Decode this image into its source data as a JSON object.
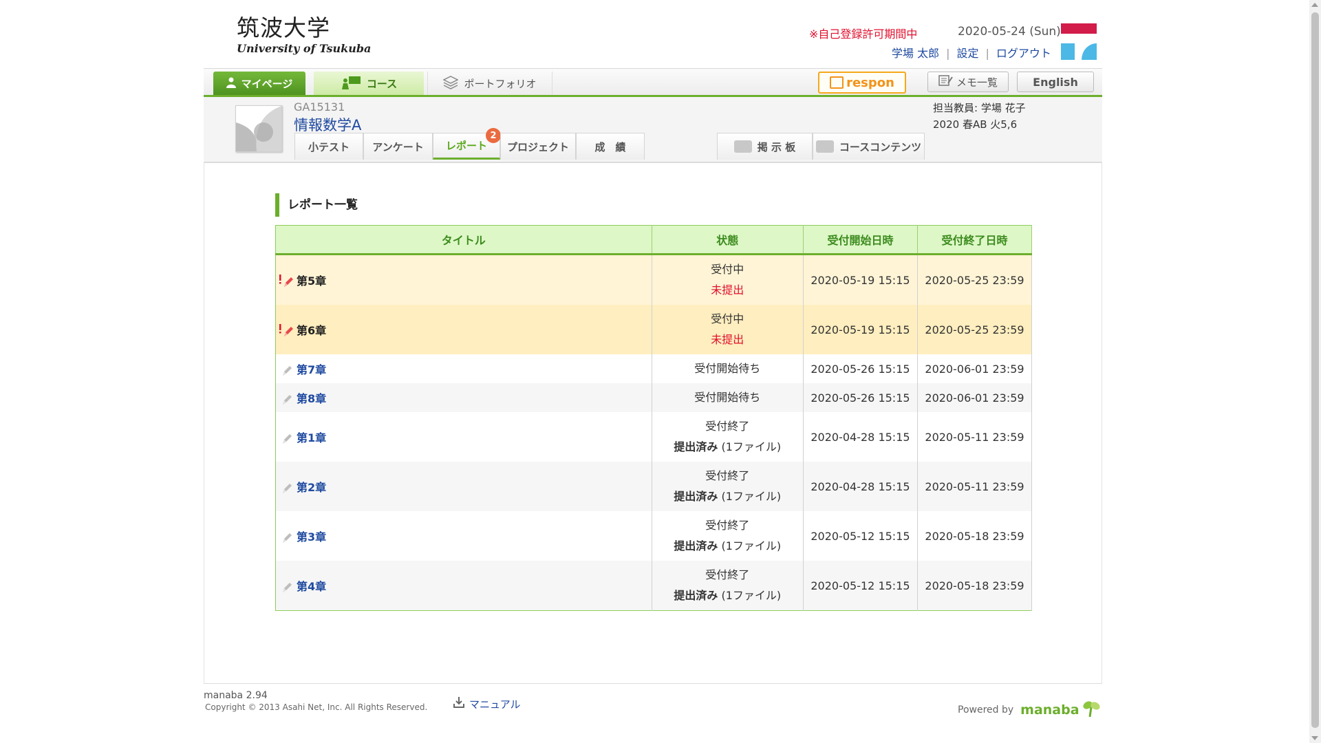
{
  "header": {
    "logo_jp": "筑波大学",
    "logo_en": "University of Tsukuba",
    "registration_notice": "※自己登録許可期間中",
    "date": "2020-05-24 (Sun)",
    "user_name": "学場 太郎",
    "settings": "設定",
    "logout": "ログアウト"
  },
  "nav": {
    "mypage": "マイページ",
    "course": "コース",
    "portfolio": "ポートフォリオ",
    "respon": "respon",
    "memo": "メモ一覧",
    "english": "English"
  },
  "course": {
    "code": "GA15131",
    "name": "情報数学A",
    "teacher": "担当教員: 学場 花子",
    "term": "2020 春AB 火5,6"
  },
  "subtabs": {
    "quiz": "小テスト",
    "survey": "アンケート",
    "report": "レポート",
    "report_badge": "2",
    "project": "プロジェクト",
    "grades": "成　績",
    "board": "掲 示 板",
    "contents": "コースコンテンツ"
  },
  "section_title": "レポート一覧",
  "table": {
    "headers": [
      "タイトル",
      "状態",
      "受付開始日時",
      "受付終了日時"
    ],
    "rows": [
      {
        "title": "第5章",
        "state": "受付中",
        "sub": "未提出",
        "subtail": "",
        "start": "2020-05-19 15:15",
        "end": "2020-05-25 23:59"
      },
      {
        "title": "第6章",
        "state": "受付中",
        "sub": "未提出",
        "subtail": "",
        "start": "2020-05-19 15:15",
        "end": "2020-05-25 23:59"
      },
      {
        "title": "第7章",
        "state": "受付開始待ち",
        "sub": "",
        "subtail": "",
        "start": "2020-05-26 15:15",
        "end": "2020-06-01 23:59"
      },
      {
        "title": "第8章",
        "state": "受付開始待ち",
        "sub": "",
        "subtail": "",
        "start": "2020-05-26 15:15",
        "end": "2020-06-01 23:59"
      },
      {
        "title": "第1章",
        "state": "受付終了",
        "sub": "提出済み",
        "subtail": " (1ファイル)",
        "start": "2020-04-28 15:15",
        "end": "2020-05-11 23:59"
      },
      {
        "title": "第2章",
        "state": "受付終了",
        "sub": "提出済み",
        "subtail": " (1ファイル)",
        "start": "2020-04-28 15:15",
        "end": "2020-05-11 23:59"
      },
      {
        "title": "第3章",
        "state": "受付終了",
        "sub": "提出済み",
        "subtail": " (1ファイル)",
        "start": "2020-05-12 15:15",
        "end": "2020-05-18 23:59"
      },
      {
        "title": "第4章",
        "state": "受付終了",
        "sub": "提出済み",
        "subtail": " (1ファイル)",
        "start": "2020-05-12 15:15",
        "end": "2020-05-18 23:59"
      }
    ]
  },
  "footer": {
    "version": "manaba 2.94",
    "copyright": "Copyright © 2013 Asahi Net, Inc. All Rights Reserved.",
    "manual": "マニュアル",
    "powered": "Powered by",
    "brand": "manaba"
  },
  "colors": {
    "accent_green": "#6cae2c",
    "link_blue": "#1f4aa0",
    "alert_red": "#e0102e",
    "highlight_row": "#fff4d6"
  }
}
